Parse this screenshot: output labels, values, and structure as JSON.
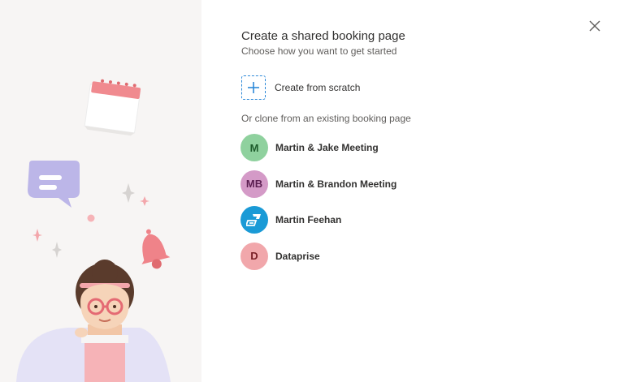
{
  "dialog": {
    "title": "Create a shared booking page",
    "subtitle": "Choose how you want to get started",
    "close_icon": "close-icon"
  },
  "create_option": {
    "label": "Create from scratch",
    "icon": "plus-icon",
    "accent_color": "#2b88d8"
  },
  "clone_section": {
    "heading": "Or clone from an existing booking page",
    "pages": [
      {
        "name": "Martin & Jake Meeting",
        "initials": "M",
        "avatar_bg": "#8fd19e",
        "avatar_fg": "#1e5c2c"
      },
      {
        "name": "Martin & Brandon Meeting",
        "initials": "MB",
        "avatar_bg": "#d49ac7",
        "avatar_fg": "#5c1f52"
      },
      {
        "name": "Martin Feehan",
        "initials": "",
        "avatar_icon": "logo-icon",
        "avatar_bg": "#1a9ad6",
        "avatar_fg": "#ffffff"
      },
      {
        "name": "Dataprise",
        "initials": "D",
        "avatar_bg": "#f1a7ab",
        "avatar_fg": "#7a1f26"
      }
    ]
  },
  "illustration": {
    "icons": [
      "calendar-icon",
      "chat-bubble-icon",
      "bell-icon",
      "sparkle-icon",
      "person-illustration"
    ]
  }
}
